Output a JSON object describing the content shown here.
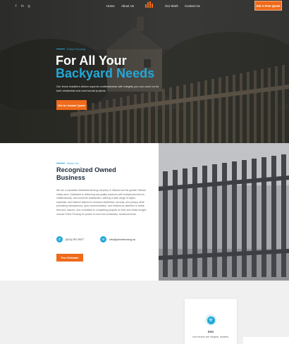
{
  "header": {
    "social": [
      "f",
      "in",
      "◎"
    ],
    "nav": [
      "Home",
      "About Us",
      "Our Work",
      "Contact Us"
    ],
    "cta_label": "Get A Free Quote"
  },
  "hero": {
    "eyebrow": "Prime Fencing",
    "title_line1": "For All Your",
    "title_line2": "Backyard Needs",
    "description": "Our fence installers deliver superior craftsmanship with integrity you can count on for both residential and commercial projects.",
    "button_label": "Get An Instant Quote"
  },
  "about": {
    "eyebrow": "About Us",
    "title": "Recognized Owned Business",
    "body": "We are a reputable residential fencing company in Ottawa and the greater Ottawa Valley area. Dedicated to delivering top-quality solutions with exceptional service, craftsmanship, and customer satisfaction, offering a wide range of styles, materials, and finishes tailored to enhance aesthetics, security, and privacy while prioritizing transparency, open communication, and meticulous attention to detail, licensed, insured, and committed to completing projects on time and within budget; choose Prime Fencing for peace of mind and a beautiful, functional fence.",
    "phone": "(613) 297-9977",
    "email": "info@primefencing.ca",
    "button_label": "Free Estimate"
  },
  "services": {
    "card_title": "Iron",
    "card_desc": "Iron fences are elegant, durable,"
  },
  "colors": {
    "accent_orange": "#ef6a1a",
    "accent_blue": "#22a8d8",
    "heading_dark": "#1f2d3d"
  }
}
